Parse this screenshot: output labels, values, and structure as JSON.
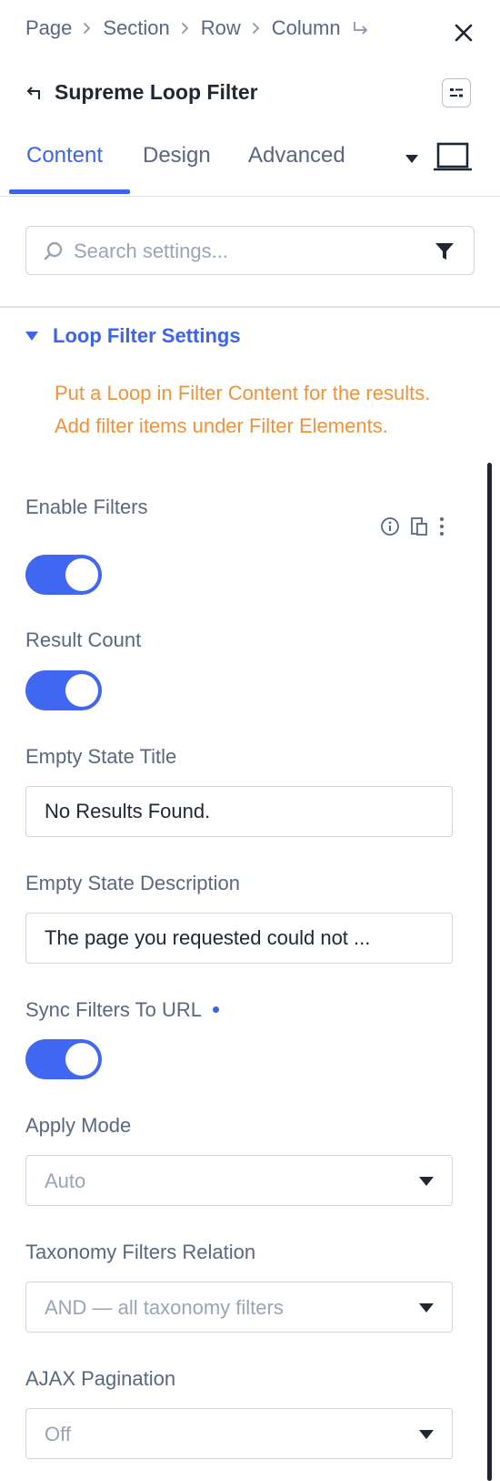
{
  "breadcrumb": [
    "Page",
    "Section",
    "Row",
    "Column"
  ],
  "panel": {
    "title": "Supreme Loop Filter"
  },
  "tabs": [
    "Content",
    "Design",
    "Advanced"
  ],
  "search": {
    "placeholder": "Search settings..."
  },
  "section": {
    "title": "Loop Filter Settings",
    "notice": "Put a Loop in Filter Content for the results. Add filter items under Filter Elements."
  },
  "fields": {
    "enable_filters": {
      "label": "Enable Filters",
      "on": true
    },
    "result_count": {
      "label": "Result Count",
      "on": true
    },
    "empty_state_title": {
      "label": "Empty State Title",
      "value": "No Results Found."
    },
    "empty_state_description": {
      "label": "Empty State Description",
      "value": "The page you requested could not ..."
    },
    "sync_filters": {
      "label": "Sync Filters To URL",
      "on": true
    },
    "apply_mode": {
      "label": "Apply Mode",
      "value": "Auto"
    },
    "taxonomy_relation": {
      "label": "Taxonomy Filters Relation",
      "value": "AND — all taxonomy filters"
    },
    "ajax_pagination": {
      "label": "AJAX Pagination",
      "value": "Off"
    }
  },
  "colors": {
    "accent": "#3b63f0",
    "notice": "#f0923a",
    "label": "#5a6780",
    "border": "#cfd5de"
  },
  "icons": [
    "chevron-right-icon",
    "enter-arrow-icon",
    "close-icon",
    "back-arrow-icon",
    "layout-icon",
    "caret-down-icon",
    "laptop-icon",
    "search-icon",
    "filter-icon",
    "info-icon",
    "responsive-icon",
    "more-vertical-icon"
  ]
}
